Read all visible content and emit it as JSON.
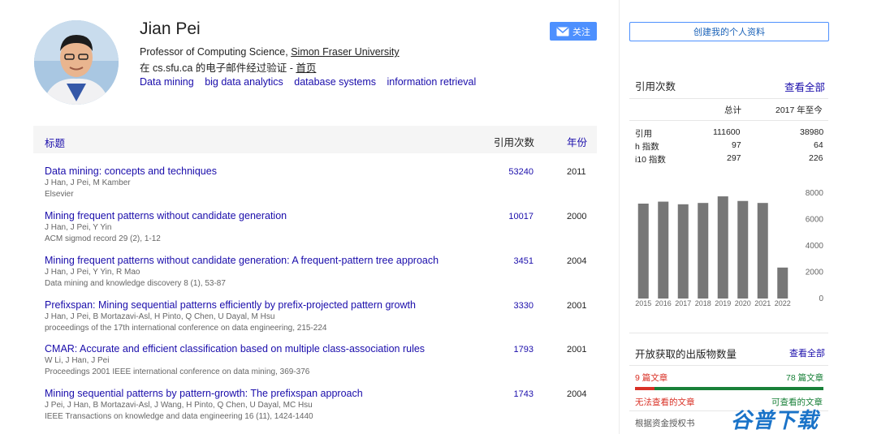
{
  "profile": {
    "name": "Jian Pei",
    "affiliation_prefix": "Professor of Computing Science, ",
    "affiliation_link": "Simon Fraser University",
    "verified_prefix": "在 cs.sfu.ca 的电子邮件经过验证 - ",
    "verified_link": "首页",
    "interests": [
      "Data mining",
      "big data analytics",
      "database systems",
      "information retrieval"
    ]
  },
  "buttons": {
    "follow": "关注",
    "create_profile": "创建我的个人资料"
  },
  "table": {
    "headers": {
      "title": "标题",
      "cited_by": "引用次数",
      "year": "年份"
    },
    "rows": [
      {
        "title": "Data mining: concepts and techniques",
        "authors": "J Han, J Pei, M Kamber",
        "venue": "Elsevier",
        "cited": "53240",
        "year": "2011"
      },
      {
        "title": "Mining frequent patterns without candidate generation",
        "authors": "J Han, J Pei, Y Yin",
        "venue": "ACM sigmod record 29 (2), 1-12",
        "cited": "10017",
        "year": "2000"
      },
      {
        "title": "Mining frequent patterns without candidate generation: A frequent-pattern tree approach",
        "authors": "J Han, J Pei, Y Yin, R Mao",
        "venue": "Data mining and knowledge discovery 8 (1), 53-87",
        "cited": "3451",
        "year": "2004"
      },
      {
        "title": "Prefixspan: Mining sequential patterns efficiently by prefix-projected pattern growth",
        "authors": "J Han, J Pei, B Mortazavi-Asl, H Pinto, Q Chen, U Dayal, M Hsu",
        "venue": "proceedings of the 17th international conference on data engineering, 215-224",
        "cited": "3330",
        "year": "2001"
      },
      {
        "title": "CMAR: Accurate and efficient classification based on multiple class-association rules",
        "authors": "W Li, J Han, J Pei",
        "venue": "Proceedings 2001 IEEE international conference on data mining, 369-376",
        "cited": "1793",
        "year": "2001"
      },
      {
        "title": "Mining sequential patterns by pattern-growth: The prefixspan approach",
        "authors": "J Pei, J Han, B Mortazavi-Asl, J Wang, H Pinto, Q Chen, U Dayal, MC Hsu",
        "venue": "IEEE Transactions on knowledge and data engineering 16 (11), 1424-1440",
        "cited": "1743",
        "year": "2004"
      }
    ]
  },
  "citations": {
    "title": "引用次数",
    "view_all": "查看全部",
    "col_total": "总计",
    "col_since": "2017 年至今",
    "rows": [
      {
        "label": "引用",
        "total": "111600",
        "since": "38980"
      },
      {
        "label": "h 指数",
        "total": "97",
        "since": "64"
      },
      {
        "label": "i10 指数",
        "total": "297",
        "since": "226"
      }
    ]
  },
  "chart_data": {
    "type": "bar",
    "categories": [
      "2015",
      "2016",
      "2017",
      "2018",
      "2019",
      "2020",
      "2021",
      "2022"
    ],
    "values": [
      7200,
      7350,
      7150,
      7250,
      7750,
      7400,
      7250,
      2350
    ],
    "ylim": [
      0,
      8000
    ],
    "yticks": [
      "8000",
      "6000",
      "4000",
      "2000",
      "0"
    ],
    "bar_color": "#777777"
  },
  "open_access": {
    "title": "开放获取的出版物数量",
    "view_all": "查看全部",
    "unavailable_label": "9 篇文章",
    "available_label": "78 篇文章",
    "unavailable_text": "无法查看的文章",
    "available_text": "可查看的文章",
    "unavailable_count": 9,
    "available_count": 78,
    "funding": "根据资金授权书"
  },
  "watermark": "谷普下载",
  "colors": {
    "link": "#1a0dab",
    "accent": "#4d90fe",
    "red": "#d93025",
    "green": "#188038"
  }
}
